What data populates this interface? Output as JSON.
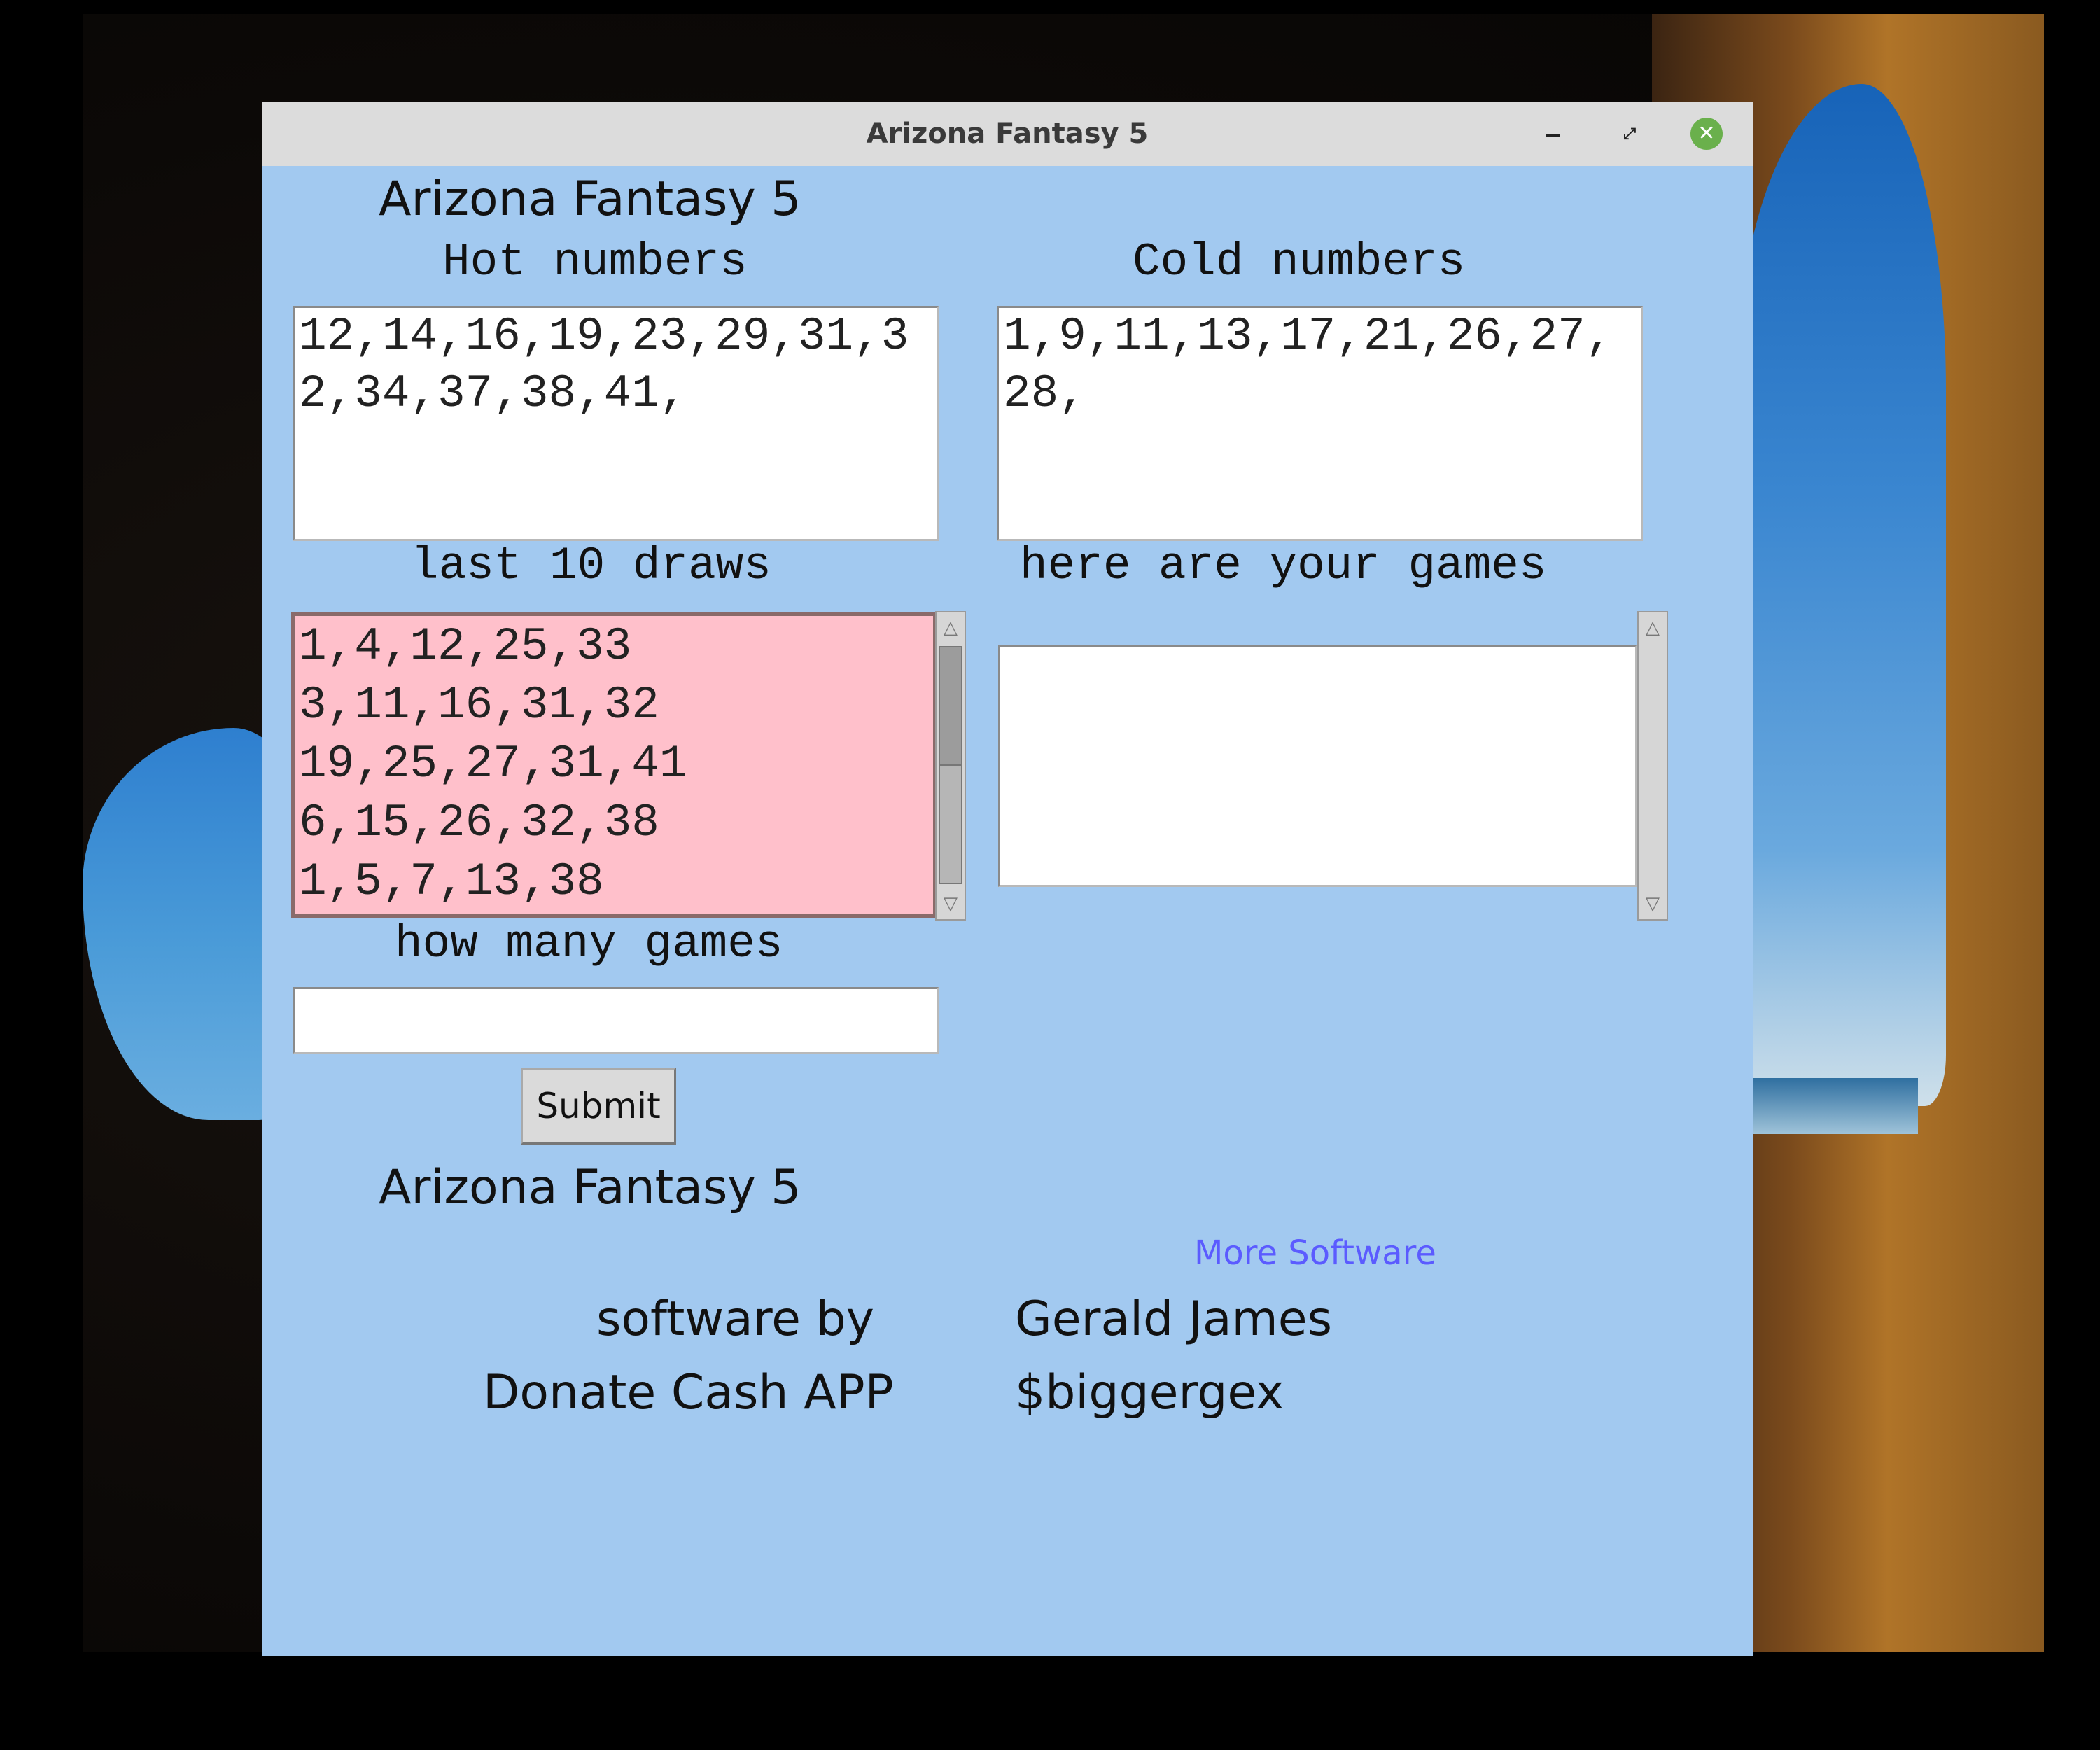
{
  "window": {
    "title": "Arizona Fantasy 5",
    "minimize_symbol": "−",
    "maximize_symbol": "⤢",
    "close_symbol": "✕"
  },
  "app": {
    "heading_top": "Arizona Fantasy 5",
    "hot_label": "Hot numbers",
    "hot_value": "12,14,16,19,23,29,31,32,34,37,38,41,",
    "cold_label": "Cold numbers",
    "cold_value": "1,9,11,13,17,21,26,27,28,",
    "draws_label": "last 10 draws",
    "draws_value": "1,4,12,25,33\n3,11,16,31,32\n19,25,27,31,41\n6,15,26,32,38\n1,5,7,13,38",
    "games_label": "here are your games",
    "games_value": "",
    "how_many_label": "how many games",
    "how_many_value": "",
    "submit_label": "Submit",
    "heading_bottom": "Arizona Fantasy 5",
    "more_software_link": "More Software",
    "software_by_label": "software by",
    "author_name": "Gerald James",
    "donate_label": "Donate Cash APP",
    "cashapp_handle": "$biggergex"
  },
  "colors": {
    "window_bg": "#a2c9f0",
    "draws_bg": "#ffc0cb",
    "link": "#5b5bff",
    "close_button": "#6ab04c"
  }
}
